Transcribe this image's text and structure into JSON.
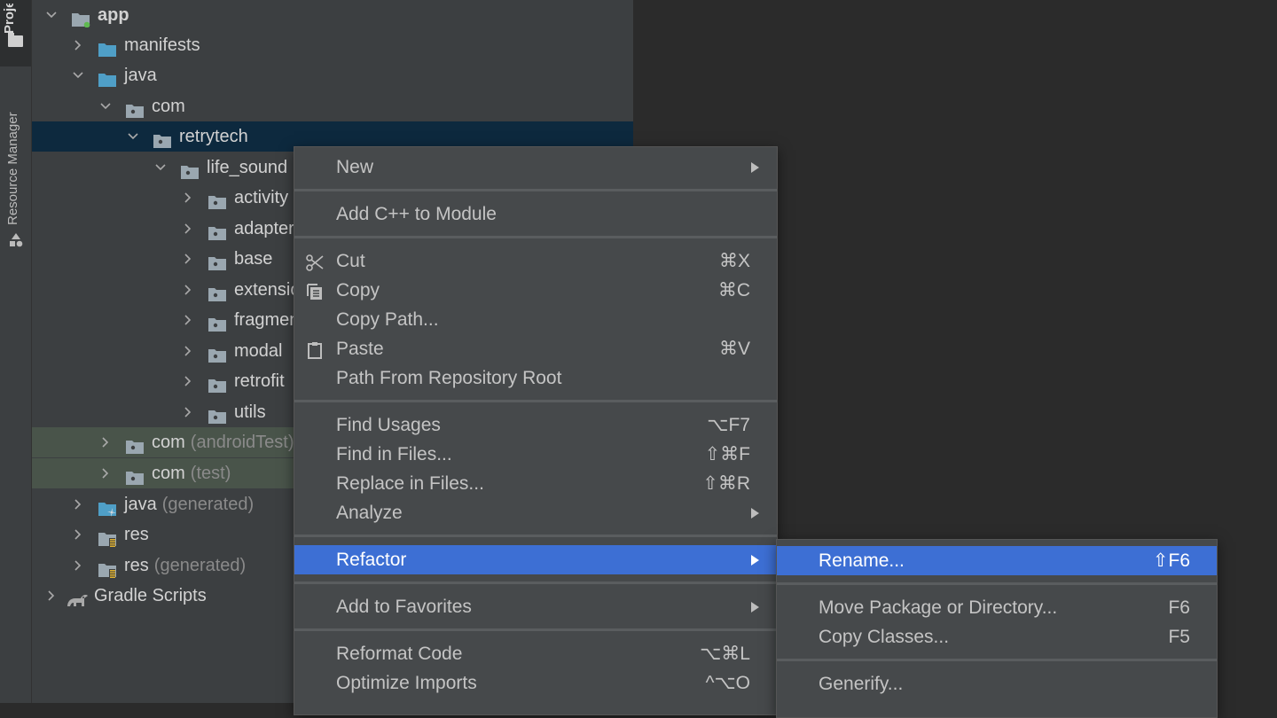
{
  "toolstrip": {
    "project_label": "Project",
    "resource_manager_label": "Resource Manager"
  },
  "tree": [
    {
      "label": "app",
      "suffix": "",
      "level": 0,
      "expanded": true,
      "icon": "module-folder-icon"
    },
    {
      "label": "manifests",
      "suffix": "",
      "level": 1,
      "expanded": false,
      "icon": "source-folder-icon"
    },
    {
      "label": "java",
      "suffix": "",
      "level": 1,
      "expanded": true,
      "icon": "source-folder-icon"
    },
    {
      "label": "com",
      "suffix": "",
      "level": 2,
      "expanded": true,
      "icon": "package-icon"
    },
    {
      "label": "retrytech",
      "suffix": "",
      "level": 3,
      "expanded": true,
      "icon": "package-icon",
      "selected": true
    },
    {
      "label": "life_sound",
      "suffix": "",
      "level": 4,
      "expanded": true,
      "icon": "package-icon"
    },
    {
      "label": "activity",
      "suffix": "",
      "level": 5,
      "expanded": false,
      "icon": "package-icon"
    },
    {
      "label": "adapter",
      "suffix": "",
      "level": 5,
      "expanded": false,
      "icon": "package-icon"
    },
    {
      "label": "base",
      "suffix": "",
      "level": 5,
      "expanded": false,
      "icon": "package-icon"
    },
    {
      "label": "extension",
      "suffix": "",
      "level": 5,
      "expanded": false,
      "icon": "package-icon"
    },
    {
      "label": "fragment",
      "suffix": "",
      "level": 5,
      "expanded": false,
      "icon": "package-icon"
    },
    {
      "label": "modal",
      "suffix": "",
      "level": 5,
      "expanded": false,
      "icon": "package-icon"
    },
    {
      "label": "retrofit",
      "suffix": "",
      "level": 5,
      "expanded": false,
      "icon": "package-icon"
    },
    {
      "label": "utils",
      "suffix": "",
      "level": 5,
      "expanded": false,
      "icon": "package-icon"
    },
    {
      "label": "com",
      "suffix": "(androidTest)",
      "level": 2,
      "expanded": false,
      "icon": "package-icon",
      "test": true
    },
    {
      "label": "com",
      "suffix": "(test)",
      "level": 2,
      "expanded": false,
      "icon": "package-icon",
      "test": true
    },
    {
      "label": "java",
      "suffix": "(generated)",
      "level": 1,
      "expanded": false,
      "icon": "generated-folder-icon"
    },
    {
      "label": "res",
      "suffix": "",
      "level": 1,
      "expanded": false,
      "icon": "resource-folder-icon"
    },
    {
      "label": "res",
      "suffix": "(generated)",
      "level": 1,
      "expanded": false,
      "icon": "resource-folder-icon"
    },
    {
      "label": "Gradle Scripts",
      "suffix": "",
      "level": 0,
      "expanded": false,
      "icon": "gradle-icon"
    }
  ],
  "context_menu": {
    "items": [
      {
        "label": "New",
        "shortcut": "",
        "submenu": true
      },
      {
        "label": "Add C++ to Module",
        "shortcut": ""
      },
      {
        "label": "Cut",
        "shortcut": "⌘X",
        "icon": "scissors-icon"
      },
      {
        "label": "Copy",
        "shortcut": "⌘C",
        "icon": "copy-icon"
      },
      {
        "label": "Copy Path...",
        "shortcut": ""
      },
      {
        "label": "Paste",
        "shortcut": "⌘V",
        "icon": "clipboard-icon"
      },
      {
        "label": "Path From Repository Root",
        "shortcut": ""
      },
      {
        "label": "Find Usages",
        "shortcut": "⌥F7"
      },
      {
        "label": "Find in Files...",
        "shortcut": "⇧⌘F"
      },
      {
        "label": "Replace in Files...",
        "shortcut": "⇧⌘R"
      },
      {
        "label": "Analyze",
        "shortcut": "",
        "submenu": true
      },
      {
        "label": "Refactor",
        "shortcut": "",
        "submenu": true,
        "active": true
      },
      {
        "label": "Add to Favorites",
        "shortcut": "",
        "submenu": true
      },
      {
        "label": "Reformat Code",
        "shortcut": "⌥⌘L"
      },
      {
        "label": "Optimize Imports",
        "shortcut": "^⌥O"
      }
    ]
  },
  "refactor_submenu": {
    "items": [
      {
        "label": "Rename...",
        "shortcut": "⇧F6",
        "active": true
      },
      {
        "label": "Move Package or Directory...",
        "shortcut": "F6"
      },
      {
        "label": "Copy Classes...",
        "shortcut": "F5"
      },
      {
        "label": "Generify...",
        "shortcut": ""
      }
    ]
  },
  "colors": {
    "panel_bg": "#3c3f41",
    "editor_bg": "#2b2b2b",
    "selection": "#0d293e",
    "menu_active": "#3d6fd4",
    "test_bg": "#49544a"
  }
}
